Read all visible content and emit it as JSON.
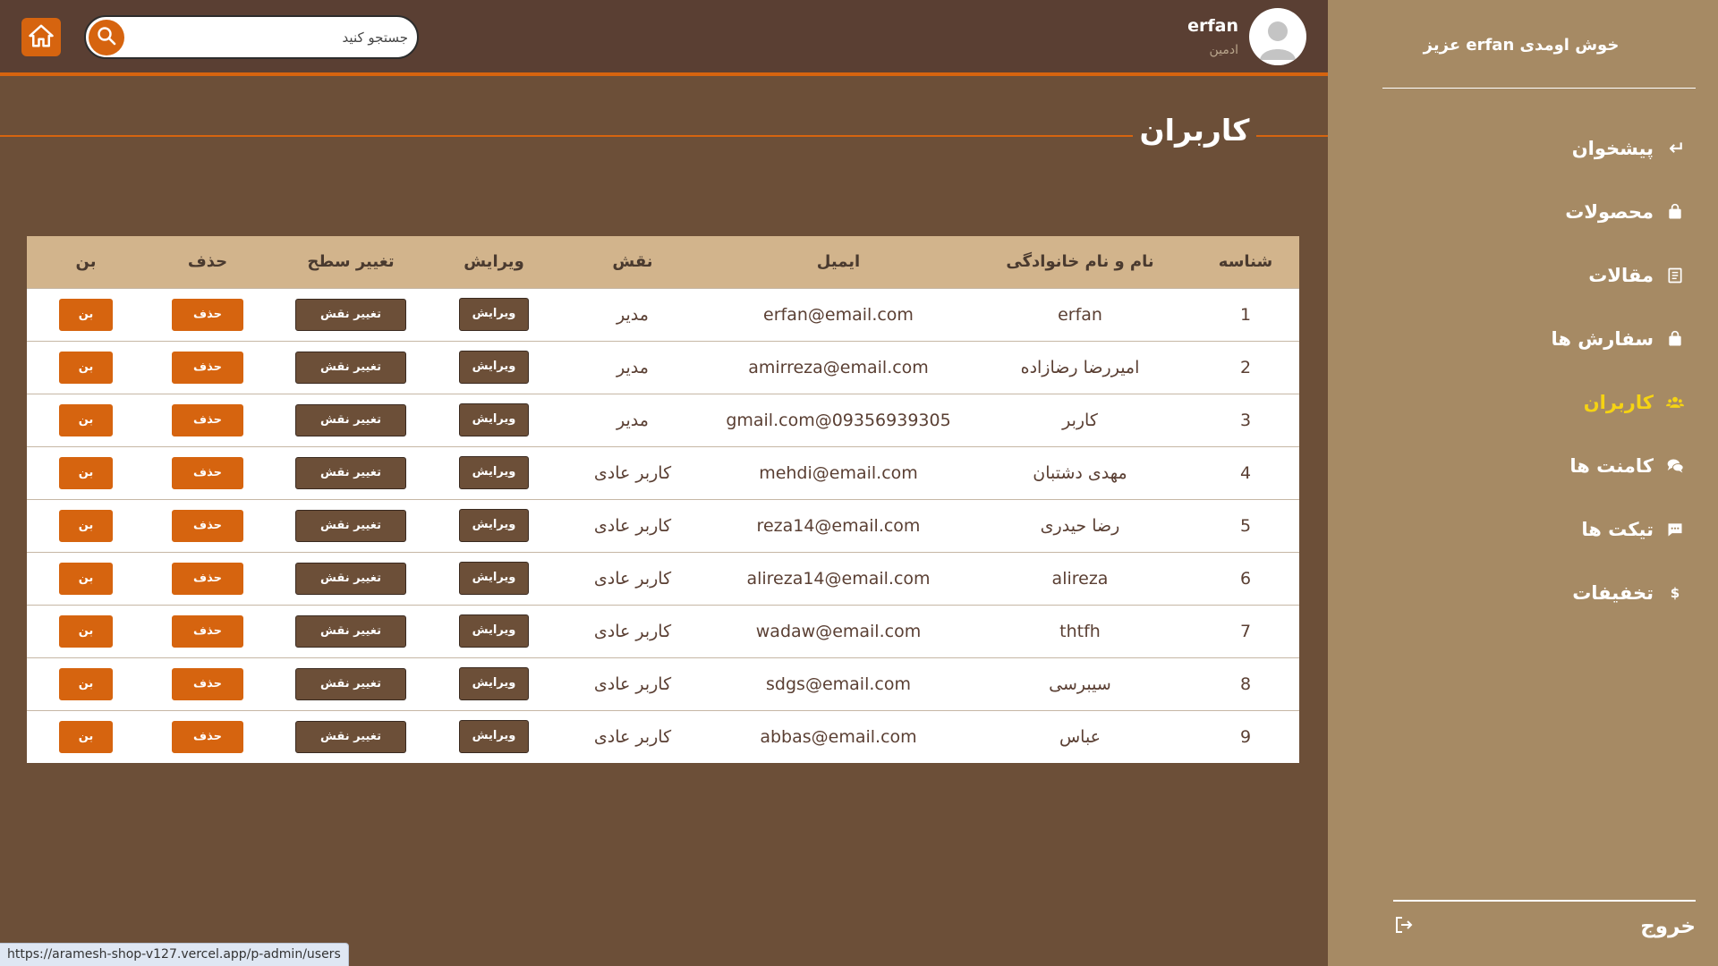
{
  "colors": {
    "accent": "#d6640f",
    "header_bg": "#5a3f33",
    "main_bg": "#6c4f38",
    "sidebar_bg": "#a68a64",
    "table_header_bg": "#d2b48c",
    "active_nav": "#f5d313"
  },
  "header": {
    "search_placeholder": "جستجو کنید",
    "user": {
      "name": "erfan",
      "role": "ادمین"
    }
  },
  "sidebar": {
    "welcome": "خوش اومدی erfan عزیز",
    "items": [
      {
        "label": "پیشخوان",
        "icon": "return-arrow-icon",
        "active": false
      },
      {
        "label": "محصولات",
        "icon": "shopping-bag-icon",
        "active": false
      },
      {
        "label": "مقالات",
        "icon": "document-icon",
        "active": false
      },
      {
        "label": "سفارش ها",
        "icon": "shopping-bag-icon",
        "active": false
      },
      {
        "label": "کاربران",
        "icon": "users-icon",
        "active": true
      },
      {
        "label": "کامنت ها",
        "icon": "comments-icon",
        "active": false
      },
      {
        "label": "تیکت ها",
        "icon": "message-icon",
        "active": false
      },
      {
        "label": "تخفیفات",
        "icon": "dollar-icon",
        "active": false
      }
    ],
    "logout": "خروج"
  },
  "page": {
    "title": "کاربران"
  },
  "table": {
    "columns": [
      "شناسه",
      "نام و نام خانوادگی",
      "ایمیل",
      "نقش",
      "ویرایش",
      "تغییر سطح",
      "حذف",
      "بن"
    ],
    "buttons": {
      "edit": "ویرایش",
      "change_role": "تغییر نقش",
      "delete": "حذف",
      "ban": "بن"
    },
    "rows": [
      {
        "id": "1",
        "name": "erfan",
        "email": "erfan@email.com",
        "role": "مدیر"
      },
      {
        "id": "2",
        "name": "امیررضا رضازاده",
        "email": "amirreza@email.com",
        "role": "مدیر"
      },
      {
        "id": "3",
        "name": "کاربر",
        "email": "gmail.com@09356939305",
        "role": "مدیر"
      },
      {
        "id": "4",
        "name": "مهدی دشتبان",
        "email": "mehdi@email.com",
        "role": "کاربر عادی"
      },
      {
        "id": "5",
        "name": "رضا حیدری",
        "email": "reza14@email.com",
        "role": "کاربر عادی"
      },
      {
        "id": "6",
        "name": "alireza",
        "email": "alireza14@email.com",
        "role": "کاربر عادی"
      },
      {
        "id": "7",
        "name": "thtfh",
        "email": "wadaw@email.com",
        "role": "کاربر عادی"
      },
      {
        "id": "8",
        "name": "سیبرسی",
        "email": "sdgs@email.com",
        "role": "کاربر عادی"
      },
      {
        "id": "9",
        "name": "عباس",
        "email": "abbas@email.com",
        "role": "کاربر عادی"
      }
    ]
  },
  "status_bar": {
    "url": "https://aramesh-shop-v127.vercel.app/p-admin/users"
  }
}
